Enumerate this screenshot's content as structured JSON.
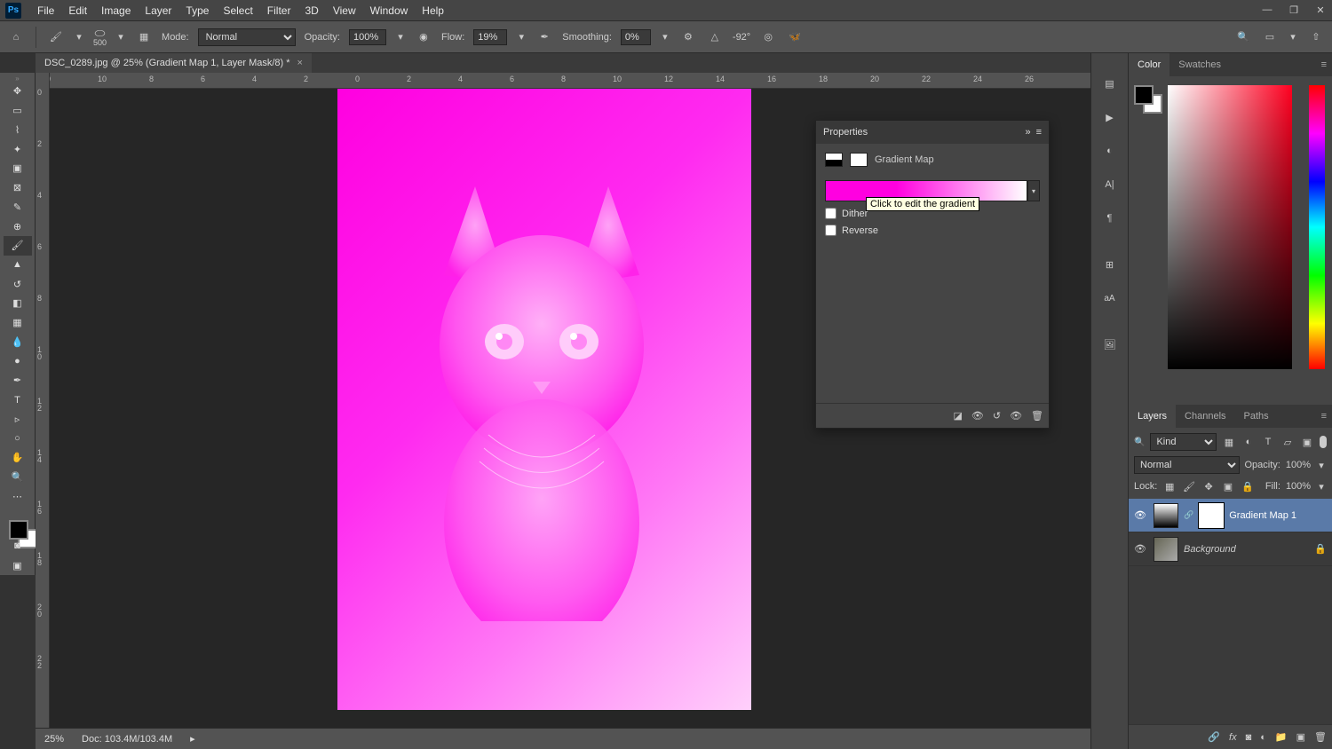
{
  "menu": {
    "items": [
      "File",
      "Edit",
      "Image",
      "Layer",
      "Type",
      "Select",
      "Filter",
      "3D",
      "View",
      "Window",
      "Help"
    ]
  },
  "options": {
    "brush_size": "500",
    "mode_label": "Mode:",
    "mode_value": "Normal",
    "opacity_label": "Opacity:",
    "opacity_value": "100%",
    "flow_label": "Flow:",
    "flow_value": "19%",
    "smoothing_label": "Smoothing:",
    "smoothing_value": "0%",
    "angle_value": "-92°"
  },
  "tab": {
    "title": "DSC_0289.jpg @ 25% (Gradient Map 1, Layer Mask/8) *"
  },
  "ruler_h": [
    "0",
    "10",
    "8",
    "6",
    "4",
    "2",
    "0",
    "2",
    "4",
    "6",
    "8",
    "10",
    "12",
    "14",
    "16",
    "18",
    "20",
    "22",
    "24",
    "26"
  ],
  "ruler_v": [
    "0",
    "2",
    "4",
    "6",
    "8",
    "1\n0",
    "1\n2",
    "1\n4",
    "1\n6",
    "1\n8",
    "2\n0",
    "2\n2"
  ],
  "status": {
    "zoom": "25%",
    "doc": "Doc: 103.4M/103.4M"
  },
  "props": {
    "title": "Properties",
    "type": "Gradient Map",
    "dither": "Dither",
    "reverse": "Reverse",
    "tooltip": "Click to edit the gradient"
  },
  "color_panel": {
    "tabs": [
      "Color",
      "Swatches"
    ]
  },
  "layers_panel": {
    "tabs": [
      "Layers",
      "Channels",
      "Paths"
    ],
    "kind": "Kind",
    "blend": "Normal",
    "opacity_label": "Opacity:",
    "opacity_value": "100%",
    "lock_label": "Lock:",
    "fill_label": "Fill:",
    "fill_value": "100%",
    "layers": [
      {
        "name": "Gradient Map 1",
        "sel": true,
        "locked": false
      },
      {
        "name": "Background",
        "sel": false,
        "locked": true
      }
    ]
  },
  "right_opt_icons": [
    "search",
    "arrange",
    "share"
  ]
}
